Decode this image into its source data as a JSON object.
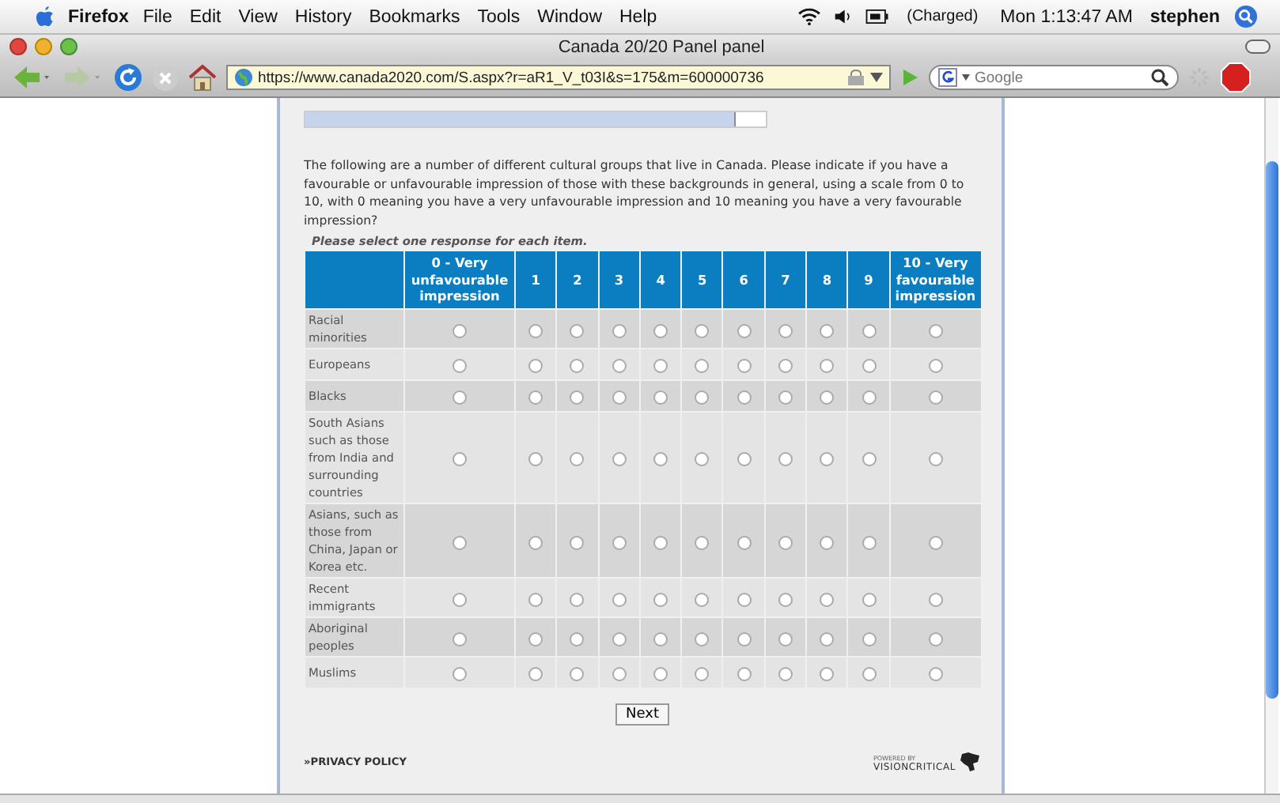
{
  "menu_bar": {
    "app": "Firefox",
    "items": [
      "File",
      "Edit",
      "View",
      "History",
      "Bookmarks",
      "Tools",
      "Window",
      "Help"
    ],
    "battery": "(Charged)",
    "clock": "Mon 1:13:47 AM",
    "user": "stephen"
  },
  "window": {
    "title": "Canada 20/20 Panel panel"
  },
  "toolbar": {
    "url": "https://www.canada2020.com/S.aspx?r=aR1_V_t03I&s=175&m=600000736",
    "search_placeholder": "Google"
  },
  "survey": {
    "progress": {
      "level": 0.93
    },
    "question": "The following are a number of different cultural groups that live in Canada.  Please indicate if you have a favourable or unfavourable impression of those with these backgrounds in general, using a scale from 0 to 10, with 0 meaning you have a very unfavourable impression and 10 meaning you have a very favourable impression?",
    "instruction": "Please select one response for each item.",
    "columns": [
      "0 - Very unfavourable impression",
      "1",
      "2",
      "3",
      "4",
      "5",
      "6",
      "7",
      "8",
      "9",
      "10 - Very favourable impression"
    ],
    "rows": [
      {
        "label": "Racial minorities",
        "selected": [
          false,
          false,
          false,
          false,
          false,
          false,
          false,
          false,
          false,
          false,
          false
        ]
      },
      {
        "label": "Europeans",
        "selected": [
          false,
          false,
          false,
          false,
          false,
          false,
          false,
          false,
          false,
          false,
          false
        ]
      },
      {
        "label": "Blacks",
        "selected": [
          false,
          false,
          false,
          false,
          false,
          false,
          false,
          false,
          false,
          false,
          false
        ]
      },
      {
        "label": "South Asians such as those from India and surrounding countries",
        "selected": [
          false,
          false,
          false,
          false,
          false,
          false,
          false,
          false,
          false,
          false,
          false
        ]
      },
      {
        "label": "Asians, such as those from China, Japan or Korea etc.",
        "selected": [
          false,
          false,
          false,
          false,
          false,
          false,
          false,
          false,
          false,
          false,
          false
        ]
      },
      {
        "label": "Recent immigrants",
        "selected": [
          false,
          false,
          false,
          false,
          false,
          false,
          false,
          false,
          false,
          false,
          false
        ]
      },
      {
        "label": "Aboriginal peoples",
        "selected": [
          false,
          false,
          false,
          false,
          false,
          false,
          false,
          false,
          false,
          false,
          false
        ]
      },
      {
        "label": "Muslims",
        "selected": [
          false,
          false,
          false,
          false,
          false,
          false,
          false,
          false,
          false,
          false,
          false
        ]
      }
    ],
    "next_button": "Next",
    "privacy_link": "»PRIVACY POLICY",
    "powered_by": "POWERED BY",
    "brand": "VISIONCRITICAL"
  }
}
